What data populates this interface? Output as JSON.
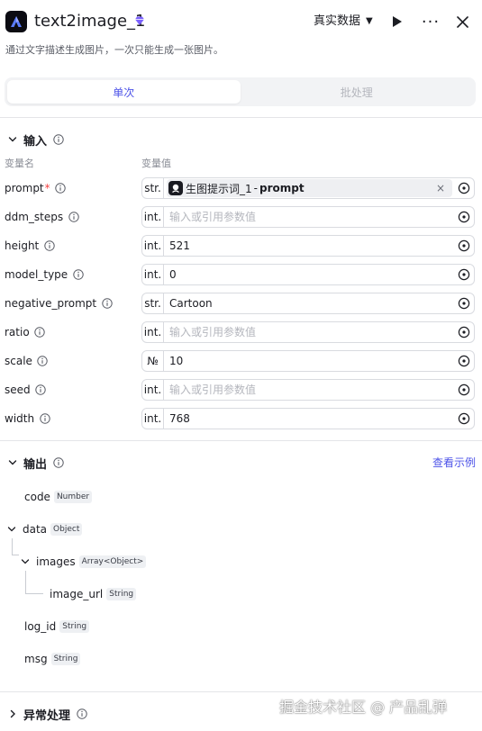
{
  "header": {
    "title": "text2image_1",
    "data_mode": "真实数据",
    "more_label": "···",
    "description": "通过文字描述生成图片，一次只能生成一张图片。"
  },
  "tabs": [
    {
      "label": "单次",
      "active": true
    },
    {
      "label": "批处理",
      "active": false
    }
  ],
  "inputs": {
    "section_title": "输入",
    "col_name": "变量名",
    "col_value": "变量值",
    "params": [
      {
        "name": "prompt",
        "required": true,
        "type": "str.",
        "ref": {
          "node": "生图提示词_1",
          "sep": "-",
          "var": "prompt",
          "clear": "×"
        }
      },
      {
        "name": "ddm_steps",
        "required": false,
        "type": "int.",
        "value": "",
        "placeholder": "输入或引用参数值"
      },
      {
        "name": "height",
        "required": false,
        "type": "int.",
        "value": "521",
        "placeholder": ""
      },
      {
        "name": "model_type",
        "required": false,
        "type": "int.",
        "value": "0",
        "placeholder": ""
      },
      {
        "name": "negative_prompt",
        "required": false,
        "type": "str.",
        "value": "Cartoon",
        "placeholder": ""
      },
      {
        "name": "ratio",
        "required": false,
        "type": "int.",
        "value": "",
        "placeholder": "输入或引用参数值"
      },
      {
        "name": "scale",
        "required": false,
        "type": "№",
        "value": "10",
        "placeholder": ""
      },
      {
        "name": "seed",
        "required": false,
        "type": "int.",
        "value": "",
        "placeholder": "输入或引用参数值"
      },
      {
        "name": "width",
        "required": false,
        "type": "int.",
        "value": "768",
        "placeholder": ""
      }
    ]
  },
  "outputs": {
    "section_title": "输出",
    "example_link": "查看示例",
    "fields": [
      {
        "name": "code",
        "type": "Number"
      },
      {
        "name": "data",
        "type": "Object"
      },
      {
        "name": "images",
        "type": "Array<Object>"
      },
      {
        "name": "image_url",
        "type": "String"
      },
      {
        "name": "log_id",
        "type": "String"
      },
      {
        "name": "msg",
        "type": "String"
      }
    ]
  },
  "error_handling": {
    "section_title": "异常处理"
  },
  "watermark": "掘金技术社区 @ 产品乱弹",
  "colors": {
    "accent": "#4d53e8",
    "badge": "#7b61ff",
    "required": "#f53f3f"
  }
}
